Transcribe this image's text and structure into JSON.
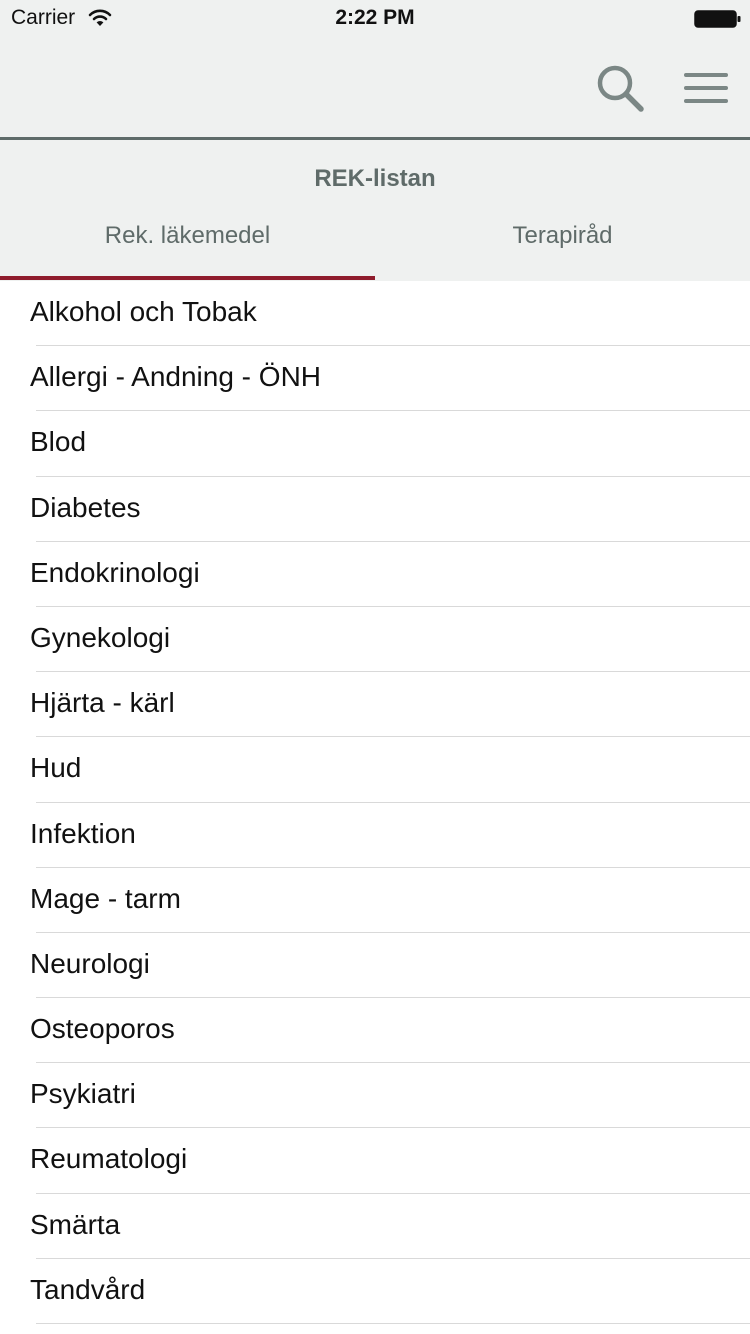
{
  "status_bar": {
    "carrier": "Carrier",
    "time": "2:22 PM"
  },
  "nav": {
    "search_icon": "search-icon",
    "menu_icon": "hamburger-menu-icon",
    "icon_color": "#7b8785"
  },
  "header": {
    "title": "REK-listan",
    "tabs": [
      {
        "label": "Rek. läkemedel",
        "selected": true
      },
      {
        "label": "Terapiråd",
        "selected": false
      }
    ],
    "indicator_color": "#8f1c2c"
  },
  "list": {
    "items": [
      {
        "label": "Alkohol och Tobak"
      },
      {
        "label": "Allergi - Andning - ÖNH"
      },
      {
        "label": "Blod"
      },
      {
        "label": "Diabetes"
      },
      {
        "label": "Endokrinologi"
      },
      {
        "label": "Gynekologi"
      },
      {
        "label": "Hjärta - kärl"
      },
      {
        "label": "Hud"
      },
      {
        "label": "Infektion"
      },
      {
        "label": "Mage - tarm"
      },
      {
        "label": "Neurologi"
      },
      {
        "label": "Osteoporos"
      },
      {
        "label": "Psykiatri"
      },
      {
        "label": "Reumatologi"
      },
      {
        "label": "Smärta"
      },
      {
        "label": "Tandvård"
      }
    ]
  }
}
